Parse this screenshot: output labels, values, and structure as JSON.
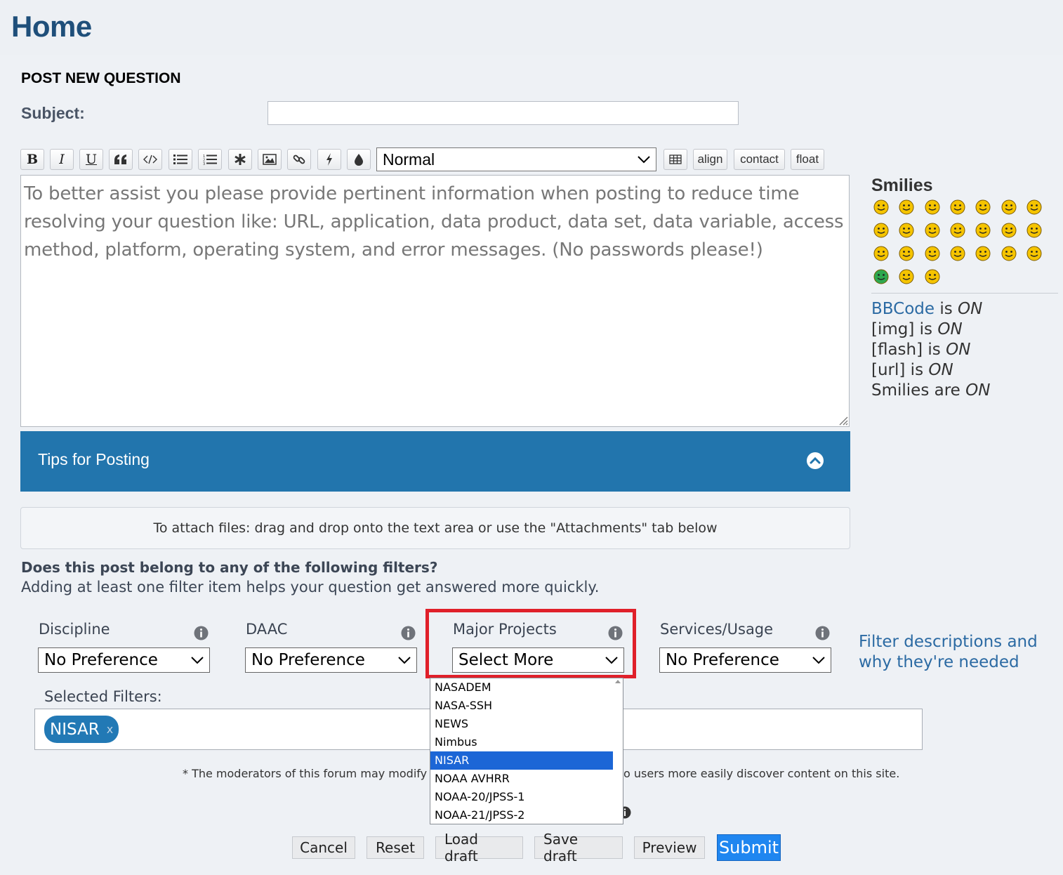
{
  "page": {
    "title": "Home"
  },
  "form": {
    "heading": "POST NEW QUESTION",
    "subject_label": "Subject:",
    "subject_value": ""
  },
  "toolbar": {
    "buttons": [
      "B",
      "I",
      "U"
    ],
    "font_size_selected": "Normal",
    "text_buttons": [
      "align",
      "contact",
      "float"
    ]
  },
  "message": {
    "placeholder": "To better assist you please provide pertinent information when posting to reduce time resolving your question like: URL, application, data product, data set, data variable, access method, platform, operating system, and error messages. (No passwords please!)"
  },
  "tips": {
    "label": "Tips for Posting"
  },
  "attach": {
    "text": "To attach files: drag and drop onto the text area or use the \"Attachments\" tab below"
  },
  "filters": {
    "question": "Does this post belong to any of the following filters?",
    "help": "Adding at least one filter item helps your question get answered more quickly.",
    "groups": [
      {
        "label": "Discipline",
        "selected": "No Preference"
      },
      {
        "label": "DAAC",
        "selected": "No Preference"
      },
      {
        "label": "Major Projects",
        "selected": "Select More"
      },
      {
        "label": "Services/Usage",
        "selected": "No Preference"
      }
    ],
    "description_link": "Filter descriptions and why they're needed",
    "selected_label": "Selected Filters:",
    "chips": [
      {
        "label": "NISAR",
        "remove": "x"
      }
    ],
    "moderator_note_start": "* The moderators of this forum may modify",
    "moderator_note_end": "o users more easily discover content on this site."
  },
  "dropdown": {
    "options": [
      "NASADEM",
      "NASA-SSH",
      "NEWS",
      "Nimbus",
      "NISAR",
      "NOAA AVHRR",
      "NOAA-20/JPSS-1",
      "NOAA-21/JPSS-2"
    ],
    "highlighted": "NISAR"
  },
  "sidebar": {
    "smilies_title": "Smilies",
    "smilies": [
      "laughing-smiley-icon",
      "neutral-smiley-icon",
      "wink-smiley-icon",
      "grin-smiley-icon",
      "shocked-smiley-icon",
      "eek-smiley-icon",
      "confused-smiley-icon",
      "cool-smiley-icon",
      "lol-smiley-icon",
      "mad-smiley-icon",
      "razz-smiley-icon",
      "oops-smiley-icon",
      "sad-smiley-icon",
      "evil-smiley-icon",
      "twisted-smiley-icon",
      "roll-smiley-icon",
      "exclaim-smiley-icon",
      "question-smiley-icon",
      "idea-smiley-icon",
      "arrow-smiley-icon",
      "neutral2-smiley-icon",
      "green-smiley-icon",
      "geek-smiley-icon",
      "ugeek-smiley-icon"
    ],
    "status": {
      "bbcode_link": "BBCode",
      "bbcode_text": " is ",
      "bbcode_state": "ON",
      "img_text": "[img] is ",
      "img_state": "ON",
      "flash_text": "[flash] is ",
      "flash_state": "ON",
      "url_text": "[url] is ",
      "url_state": "ON",
      "smilies_text": "Smilies are ",
      "smilies_state": "ON"
    }
  },
  "actions": {
    "cancel": "Cancel",
    "reset": "Reset",
    "load_draft": "Load draft",
    "save_draft": "Save draft",
    "preview": "Preview",
    "submit": "Submit"
  },
  "colors": {
    "title": "#1f4f7a",
    "tips_bar": "#2275ad",
    "chip": "#2279b5",
    "highlight_border": "#e0202a",
    "dropdown_selected": "#1c66d6",
    "submit": "#1f86f0"
  }
}
